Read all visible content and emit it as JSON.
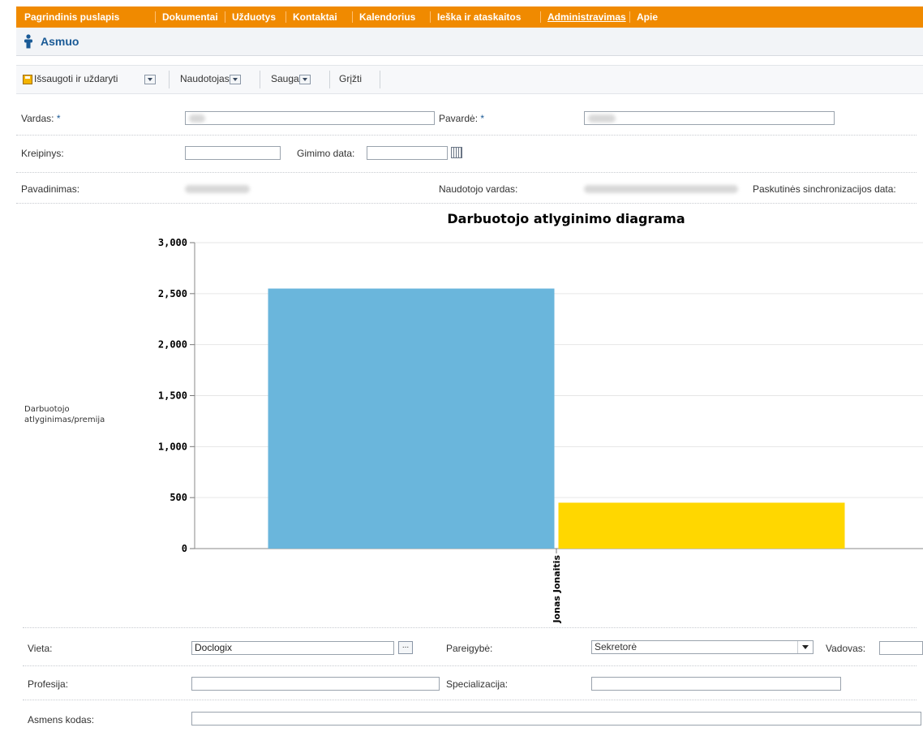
{
  "nav": {
    "items": [
      "Pagrindinis puslapis",
      "Dokumentai",
      "Užduotys",
      "Kontaktai",
      "Kalendorius",
      "Ieška ir ataskaitos",
      "Administravimas",
      "Apie"
    ],
    "active": "Administravimas",
    "color": "#f08a00"
  },
  "header": {
    "title": "Asmuo",
    "icon": "person-icon"
  },
  "toolbar": {
    "save_close": "Išsaugoti ir uždaryti",
    "user": "Naudotojas",
    "security": "Sauga",
    "back": "Grįžti"
  },
  "form": {
    "first_name_label": "Vardas:",
    "last_name_label": "Pavardė:",
    "required_mark": "*",
    "salutation_label": "Kreipinys:",
    "birth_date_label": "Gimimo data:",
    "title_label": "Pavadinimas:",
    "username_label": "Naudotojo vardas:",
    "last_sync_label": "Paskutinės sinchronizacijos data:",
    "location_label": "Vieta:",
    "location_value": "Doclogix",
    "position_label": "Pareigybė:",
    "position_value": "Sekretorė",
    "manager_label": "Vadovas:",
    "profession_label": "Profesija:",
    "specialization_label": "Specializacija:",
    "personal_code_label": "Asmens kodas:",
    "lookup_button": "..."
  },
  "chart_data": {
    "type": "bar",
    "title": "Darbuotojo atlyginimo diagrama",
    "ylabel": "Darbuotojo atlyginimas/premija",
    "categories": [
      "Jonas Jonaitis"
    ],
    "series": [
      {
        "values": [
          2550
        ],
        "color": "#6ab6dc"
      },
      {
        "values": [
          450
        ],
        "color": "#ffd700"
      }
    ],
    "ylim": [
      0,
      3000
    ],
    "yticks": [
      "0",
      "500",
      "1,000",
      "1,500",
      "2,000",
      "2,500",
      "3,000"
    ],
    "grid": true
  }
}
